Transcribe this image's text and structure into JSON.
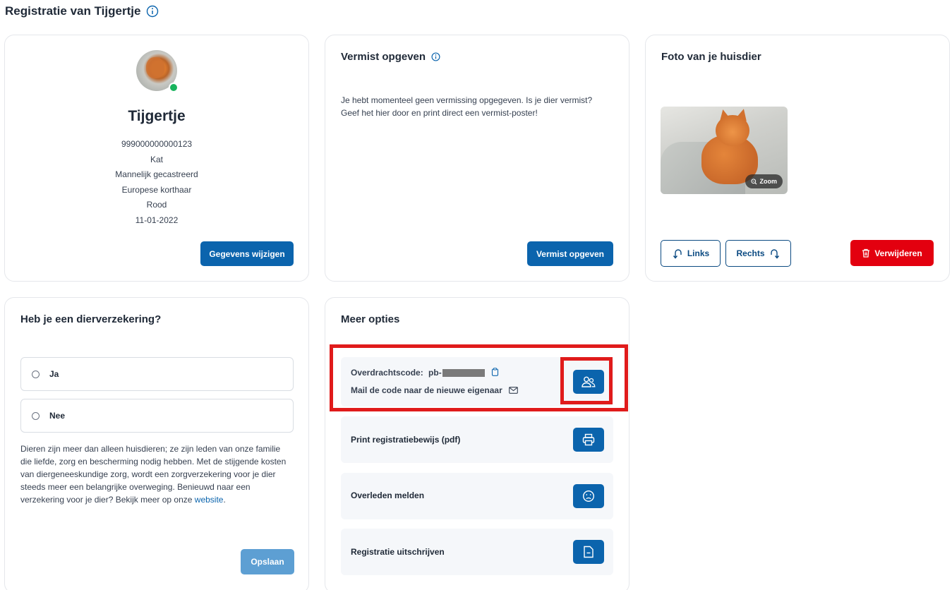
{
  "page": {
    "title": "Registratie van Tijgertje"
  },
  "profile": {
    "name": "Tijgertje",
    "chip": "999000000000123",
    "species": "Kat",
    "sex": "Mannelijk gecastreerd",
    "breed": "Europese korthaar",
    "color": "Rood",
    "birthdate": "11-01-2022",
    "online_status_color": "#18b35c",
    "edit_button": "Gegevens wijzigen"
  },
  "missing": {
    "title": "Vermist opgeven",
    "text": "Je hebt momenteel geen vermissing opgegeven. Is je dier vermist? Geef het hier door en print direct een vermist-poster!",
    "button": "Vermist opgeven"
  },
  "photo": {
    "title": "Foto van je huisdier",
    "zoom_label": "Zoom",
    "rotate_left": "Links",
    "rotate_right": "Rechts",
    "delete": "Verwijderen"
  },
  "insurance": {
    "title": "Heb je een dierverzekering?",
    "option_yes": "Ja",
    "option_no": "Nee",
    "text": "Dieren zijn meer dan alleen huisdieren; ze zijn leden van onze familie die liefde, zorg en bescherming nodig hebben. Met de stijgende kosten van diergeneeskundige zorg, wordt een zorgverzekering voor je dier steeds meer een belangrijke overweging. Benieuwd naar een verzekering voor je dier? Bekijk meer op onze",
    "link": "website",
    "link_suffix": ".",
    "save_button": "Opslaan"
  },
  "options": {
    "title": "Meer opties",
    "transfer_label": "Overdrachtscode:",
    "transfer_code_prefix": "pb-",
    "mail_code": "Mail de code naar de nieuwe eigenaar",
    "print": "Print registratiebewijs (pdf)",
    "deceased": "Overleden melden",
    "unregister": "Registratie uitschrijven"
  },
  "colors": {
    "primary": "#0b64ad",
    "danger": "#e3000f",
    "highlight": "#e01b1b"
  }
}
